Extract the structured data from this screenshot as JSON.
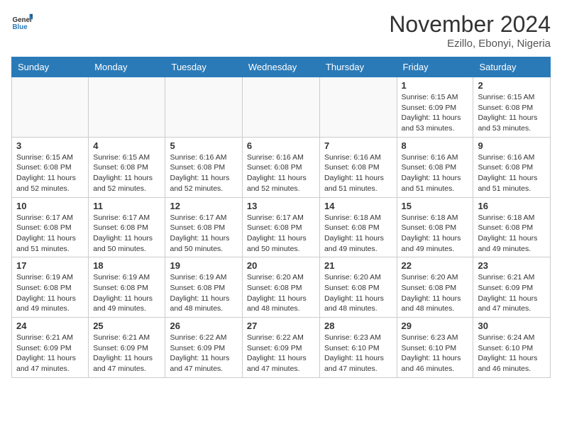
{
  "header": {
    "logo_general": "General",
    "logo_blue": "Blue",
    "month": "November 2024",
    "location": "Ezillo, Ebonyi, Nigeria"
  },
  "weekdays": [
    "Sunday",
    "Monday",
    "Tuesday",
    "Wednesday",
    "Thursday",
    "Friday",
    "Saturday"
  ],
  "weeks": [
    [
      {
        "day": "",
        "info": ""
      },
      {
        "day": "",
        "info": ""
      },
      {
        "day": "",
        "info": ""
      },
      {
        "day": "",
        "info": ""
      },
      {
        "day": "",
        "info": ""
      },
      {
        "day": "1",
        "info": "Sunrise: 6:15 AM\nSunset: 6:09 PM\nDaylight: 11 hours\nand 53 minutes."
      },
      {
        "day": "2",
        "info": "Sunrise: 6:15 AM\nSunset: 6:08 PM\nDaylight: 11 hours\nand 53 minutes."
      }
    ],
    [
      {
        "day": "3",
        "info": "Sunrise: 6:15 AM\nSunset: 6:08 PM\nDaylight: 11 hours\nand 52 minutes."
      },
      {
        "day": "4",
        "info": "Sunrise: 6:15 AM\nSunset: 6:08 PM\nDaylight: 11 hours\nand 52 minutes."
      },
      {
        "day": "5",
        "info": "Sunrise: 6:16 AM\nSunset: 6:08 PM\nDaylight: 11 hours\nand 52 minutes."
      },
      {
        "day": "6",
        "info": "Sunrise: 6:16 AM\nSunset: 6:08 PM\nDaylight: 11 hours\nand 52 minutes."
      },
      {
        "day": "7",
        "info": "Sunrise: 6:16 AM\nSunset: 6:08 PM\nDaylight: 11 hours\nand 51 minutes."
      },
      {
        "day": "8",
        "info": "Sunrise: 6:16 AM\nSunset: 6:08 PM\nDaylight: 11 hours\nand 51 minutes."
      },
      {
        "day": "9",
        "info": "Sunrise: 6:16 AM\nSunset: 6:08 PM\nDaylight: 11 hours\nand 51 minutes."
      }
    ],
    [
      {
        "day": "10",
        "info": "Sunrise: 6:17 AM\nSunset: 6:08 PM\nDaylight: 11 hours\nand 51 minutes."
      },
      {
        "day": "11",
        "info": "Sunrise: 6:17 AM\nSunset: 6:08 PM\nDaylight: 11 hours\nand 50 minutes."
      },
      {
        "day": "12",
        "info": "Sunrise: 6:17 AM\nSunset: 6:08 PM\nDaylight: 11 hours\nand 50 minutes."
      },
      {
        "day": "13",
        "info": "Sunrise: 6:17 AM\nSunset: 6:08 PM\nDaylight: 11 hours\nand 50 minutes."
      },
      {
        "day": "14",
        "info": "Sunrise: 6:18 AM\nSunset: 6:08 PM\nDaylight: 11 hours\nand 49 minutes."
      },
      {
        "day": "15",
        "info": "Sunrise: 6:18 AM\nSunset: 6:08 PM\nDaylight: 11 hours\nand 49 minutes."
      },
      {
        "day": "16",
        "info": "Sunrise: 6:18 AM\nSunset: 6:08 PM\nDaylight: 11 hours\nand 49 minutes."
      }
    ],
    [
      {
        "day": "17",
        "info": "Sunrise: 6:19 AM\nSunset: 6:08 PM\nDaylight: 11 hours\nand 49 minutes."
      },
      {
        "day": "18",
        "info": "Sunrise: 6:19 AM\nSunset: 6:08 PM\nDaylight: 11 hours\nand 49 minutes."
      },
      {
        "day": "19",
        "info": "Sunrise: 6:19 AM\nSunset: 6:08 PM\nDaylight: 11 hours\nand 48 minutes."
      },
      {
        "day": "20",
        "info": "Sunrise: 6:20 AM\nSunset: 6:08 PM\nDaylight: 11 hours\nand 48 minutes."
      },
      {
        "day": "21",
        "info": "Sunrise: 6:20 AM\nSunset: 6:08 PM\nDaylight: 11 hours\nand 48 minutes."
      },
      {
        "day": "22",
        "info": "Sunrise: 6:20 AM\nSunset: 6:08 PM\nDaylight: 11 hours\nand 48 minutes."
      },
      {
        "day": "23",
        "info": "Sunrise: 6:21 AM\nSunset: 6:09 PM\nDaylight: 11 hours\nand 47 minutes."
      }
    ],
    [
      {
        "day": "24",
        "info": "Sunrise: 6:21 AM\nSunset: 6:09 PM\nDaylight: 11 hours\nand 47 minutes."
      },
      {
        "day": "25",
        "info": "Sunrise: 6:21 AM\nSunset: 6:09 PM\nDaylight: 11 hours\nand 47 minutes."
      },
      {
        "day": "26",
        "info": "Sunrise: 6:22 AM\nSunset: 6:09 PM\nDaylight: 11 hours\nand 47 minutes."
      },
      {
        "day": "27",
        "info": "Sunrise: 6:22 AM\nSunset: 6:09 PM\nDaylight: 11 hours\nand 47 minutes."
      },
      {
        "day": "28",
        "info": "Sunrise: 6:23 AM\nSunset: 6:10 PM\nDaylight: 11 hours\nand 47 minutes."
      },
      {
        "day": "29",
        "info": "Sunrise: 6:23 AM\nSunset: 6:10 PM\nDaylight: 11 hours\nand 46 minutes."
      },
      {
        "day": "30",
        "info": "Sunrise: 6:24 AM\nSunset: 6:10 PM\nDaylight: 11 hours\nand 46 minutes."
      }
    ]
  ]
}
